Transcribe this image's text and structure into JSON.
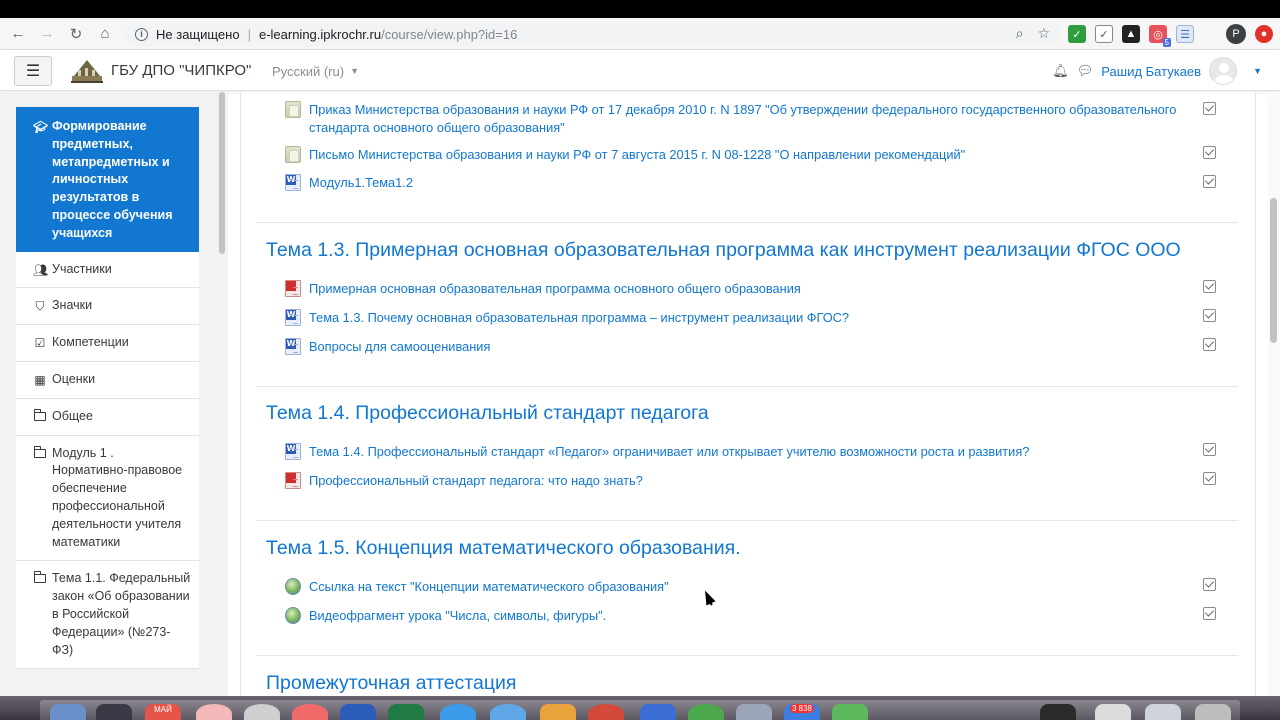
{
  "browser": {
    "security_label": "Не защищено",
    "url_host": "e-learning.ipkrochr.ru",
    "url_path": "/course/view.php?id=16",
    "profile_initial": "P",
    "extension_badge": "5"
  },
  "navbar": {
    "site_name": "ГБУ ДПО \"ЧИПКРО\"",
    "language": "Русский (ru)",
    "user_name": "Рашид Батукаев"
  },
  "drawer": {
    "items": [
      {
        "label": "Формирование предметных, метапредметных и личностных результатов в процессе обучения учащихся",
        "icon": "graduation-cap-icon",
        "active": true
      },
      {
        "label": "Участники",
        "icon": "users-icon"
      },
      {
        "label": "Значки",
        "icon": "shield-icon"
      },
      {
        "label": "Компетенции",
        "icon": "checkbox-icon"
      },
      {
        "label": "Оценки",
        "icon": "table-icon"
      },
      {
        "label": "Общее",
        "icon": "folder-icon"
      },
      {
        "label": "Модуль 1 . Нормативно-правовое обеспечение профессиональной деятельности учителя математики",
        "icon": "folder-icon"
      },
      {
        "label": "Тема 1.1. Федеральный закон «Об образовании в Российской Федерации» (№273-ФЗ)",
        "icon": "folder-icon"
      }
    ]
  },
  "content": {
    "activities_top": [
      {
        "label": "Приказ Министерства образования и науки РФ от 17 декабря 2010 г. N 1897 \"Об утверждении федерального государственного образовательного стандарта основного общего образования\"",
        "icon": "file-icon"
      },
      {
        "label": "Письмо Министерства образования и науки РФ от 7 августа 2015 г. N 08-1228 \"О направлении рекомендаций\"",
        "icon": "file-icon"
      },
      {
        "label": "Модуль1.Тема1.2",
        "icon": "word-document-icon"
      }
    ],
    "sections": [
      {
        "title": "Тема 1.3. Примерная основная образовательная программа как инструмент реализации ФГОС ООО",
        "activities": [
          {
            "label": "Примерная основная образовательная программа основного общего образования",
            "icon": "pdf-icon"
          },
          {
            "label": "Тема 1.3. Почему основная образовательная программа – инструмент реализации ФГОС?",
            "icon": "word-document-icon"
          },
          {
            "label": "Вопросы для самооценивания",
            "icon": "word-document-icon"
          }
        ]
      },
      {
        "title": "Тема 1.4. Профессиональный стандарт педагога",
        "activities": [
          {
            "label": "Тема 1.4. Профессиональный стандарт «Педагог» ограничивает или открывает учителю возможности роста и развития?",
            "icon": "word-document-icon"
          },
          {
            "label": "Профессиональный стандарт педагога: что надо знать?",
            "icon": "pdf-icon"
          }
        ]
      },
      {
        "title": "Тема 1.5. Концепция математического образования.",
        "activities": [
          {
            "label": "Ссылка на текст \"Концепции математического образования\"",
            "icon": "url-globe-icon"
          },
          {
            "label": "Видеофрагмент урока \"Числа, символы, фигуры\".",
            "icon": "url-globe-icon"
          }
        ]
      },
      {
        "title": "Промежуточная аттестация",
        "activities": []
      }
    ]
  },
  "dock": {
    "calendar_label": "МАЙ",
    "mail_badge": "3 838"
  }
}
